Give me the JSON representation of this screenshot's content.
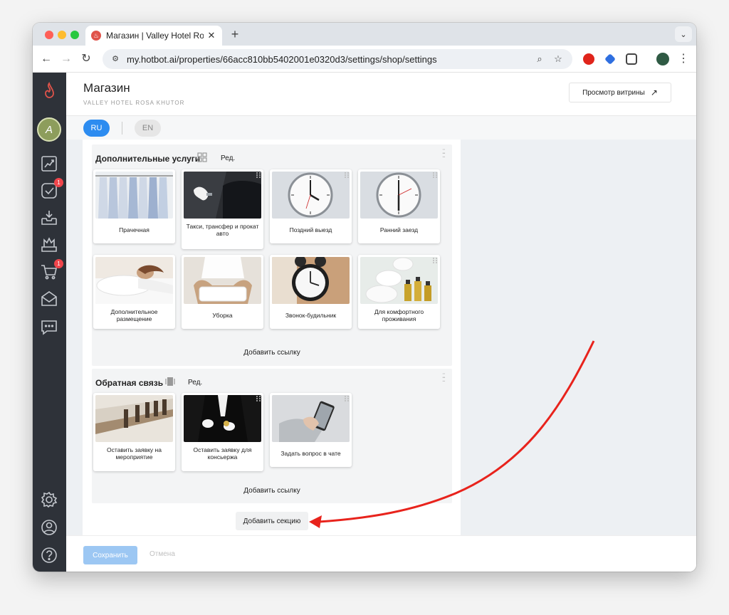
{
  "browser": {
    "tab_title": "Магазин | Valley Hotel Rosa K",
    "tab_close": "✕",
    "new_tab": "+",
    "url": "my.hotbot.ai/properties/66acc810bb5402001e0320d3/settings/shop/settings"
  },
  "sidebar": {
    "avatar_letter": "A",
    "badges": {
      "tasks": "1",
      "cart": "1"
    }
  },
  "header": {
    "title": "Магазин",
    "subtitle": "VALLEY HOTEL ROSA KHUTOR",
    "preview_label": "Просмотр витрины",
    "preview_arrow": "↗"
  },
  "languages": {
    "active": "RU",
    "other": "EN"
  },
  "sections": [
    {
      "title": "Дополнительные услуги",
      "edit_label": "Ред.",
      "add_link_label": "Добавить ссылку",
      "cards": [
        {
          "label": "Прачечная",
          "image": "laundry"
        },
        {
          "label": "Такси, трансфер и прокат авто",
          "image": "car-door"
        },
        {
          "label": "Поздний выезд",
          "image": "clock"
        },
        {
          "label": "Ранний заезд",
          "image": "clock"
        },
        {
          "label": "Дополнительное размещение",
          "image": "sleeping"
        },
        {
          "label": "Уборка",
          "image": "towels"
        },
        {
          "label": "Звонок-будильник",
          "image": "alarm-clock"
        },
        {
          "label": "Для комфортного проживания",
          "image": "toiletries"
        }
      ]
    },
    {
      "title": "Обратная связь",
      "edit_label": "Ред.",
      "add_link_label": "Добавить ссылку",
      "cards": [
        {
          "label": "Оставить заявку на мероприятие",
          "image": "conference-room"
        },
        {
          "label": "Оставить заявку для консьержа",
          "image": "concierge"
        },
        {
          "label": "Задать вопрос в чате",
          "image": "phone-chat"
        }
      ]
    }
  ],
  "add_section_label": "Добавить секцию",
  "footer": {
    "save_label": "Сохранить",
    "cancel_label": "Отмена"
  },
  "colors": {
    "primary": "#2d8cf0",
    "sidebar": "#2e3239",
    "annotation_arrow": "#e8231c"
  }
}
